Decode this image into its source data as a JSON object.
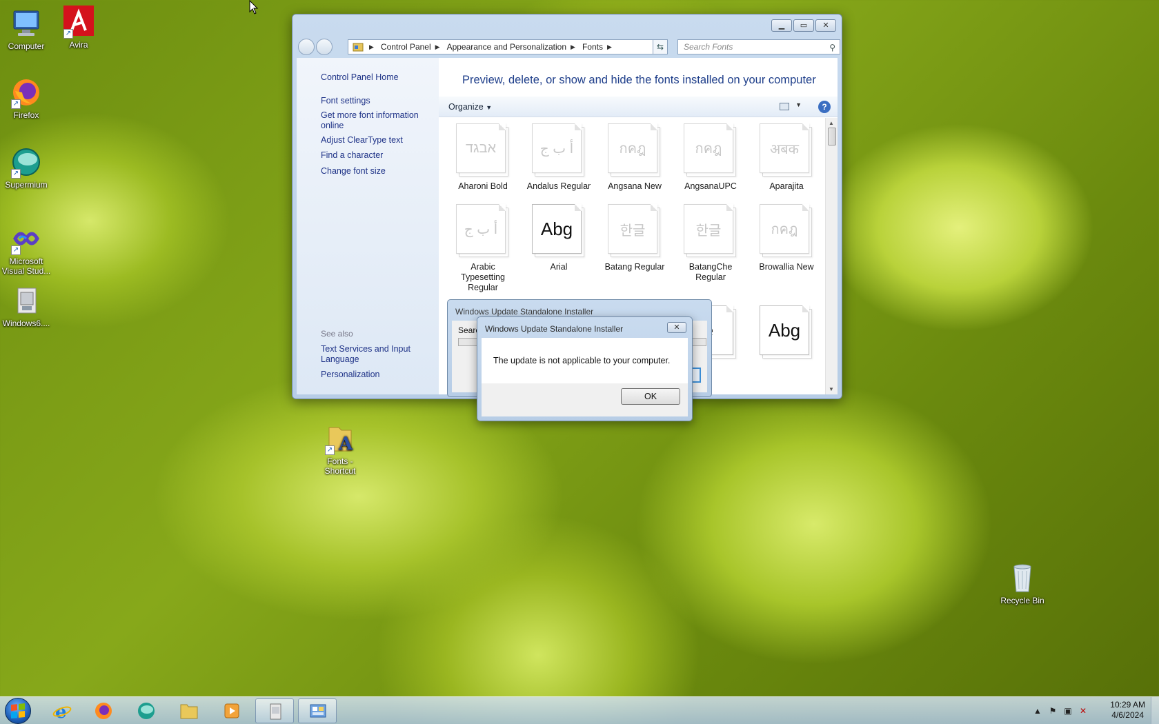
{
  "desktop": {
    "icons": [
      {
        "label": "Computer"
      },
      {
        "label": "Avira"
      },
      {
        "label": "Firefox"
      },
      {
        "label": "Supermium"
      },
      {
        "label": "Microsoft Visual Stud..."
      },
      {
        "label": "Windows6...."
      },
      {
        "label": "Fonts - Shortcut"
      },
      {
        "label": "Recycle Bin"
      }
    ]
  },
  "window": {
    "breadcrumb": [
      "Control Panel",
      "Appearance and Personalization",
      "Fonts"
    ],
    "search_placeholder": "Search Fonts",
    "left_links": [
      "Control Panel Home",
      "Font settings",
      "Get more font information online",
      "Adjust ClearType text",
      "Find a character",
      "Change font size"
    ],
    "see_also_title": "See also",
    "see_also_links": [
      "Text Services and Input Language",
      "Personalization"
    ],
    "page_title": "Preview, delete, or show and hide the fonts installed on your computer",
    "toolbar": {
      "organize": "Organize"
    },
    "help": "?",
    "fonts": [
      {
        "name": "Aharoni Bold",
        "sample": "אבגד",
        "dark": false
      },
      {
        "name": "Andalus Regular",
        "sample": "أ ب ج",
        "dark": false
      },
      {
        "name": "Angsana New",
        "sample": "กคฎ",
        "dark": false
      },
      {
        "name": "AngsanaUPC",
        "sample": "กคฎ",
        "dark": false
      },
      {
        "name": "Aparajita",
        "sample": "अबक",
        "dark": false
      },
      {
        "name": "Arabic Typesetting Regular",
        "sample": "أ ب ج",
        "dark": false
      },
      {
        "name": "Arial",
        "sample": "Abg",
        "dark": true
      },
      {
        "name": "Batang Regular",
        "sample": "한글",
        "dark": false
      },
      {
        "name": "BatangChe Regular",
        "sample": "한글",
        "dark": false
      },
      {
        "name": "Browallia New",
        "sample": "กคฎ",
        "dark": false
      }
    ],
    "row3_partial": [
      {
        "sample": "ě",
        "dark": true
      },
      {
        "sample": "Abg",
        "dark": true
      }
    ]
  },
  "dialog_back": {
    "title": "Windows Update Standalone Installer",
    "label": "Searc"
  },
  "dialog": {
    "title": "Windows Update Standalone Installer",
    "message": "The update is not applicable to your computer.",
    "ok": "OK",
    "close": "✕"
  },
  "taskbar": {
    "time": "10:29 AM",
    "date": "4/6/2024"
  }
}
